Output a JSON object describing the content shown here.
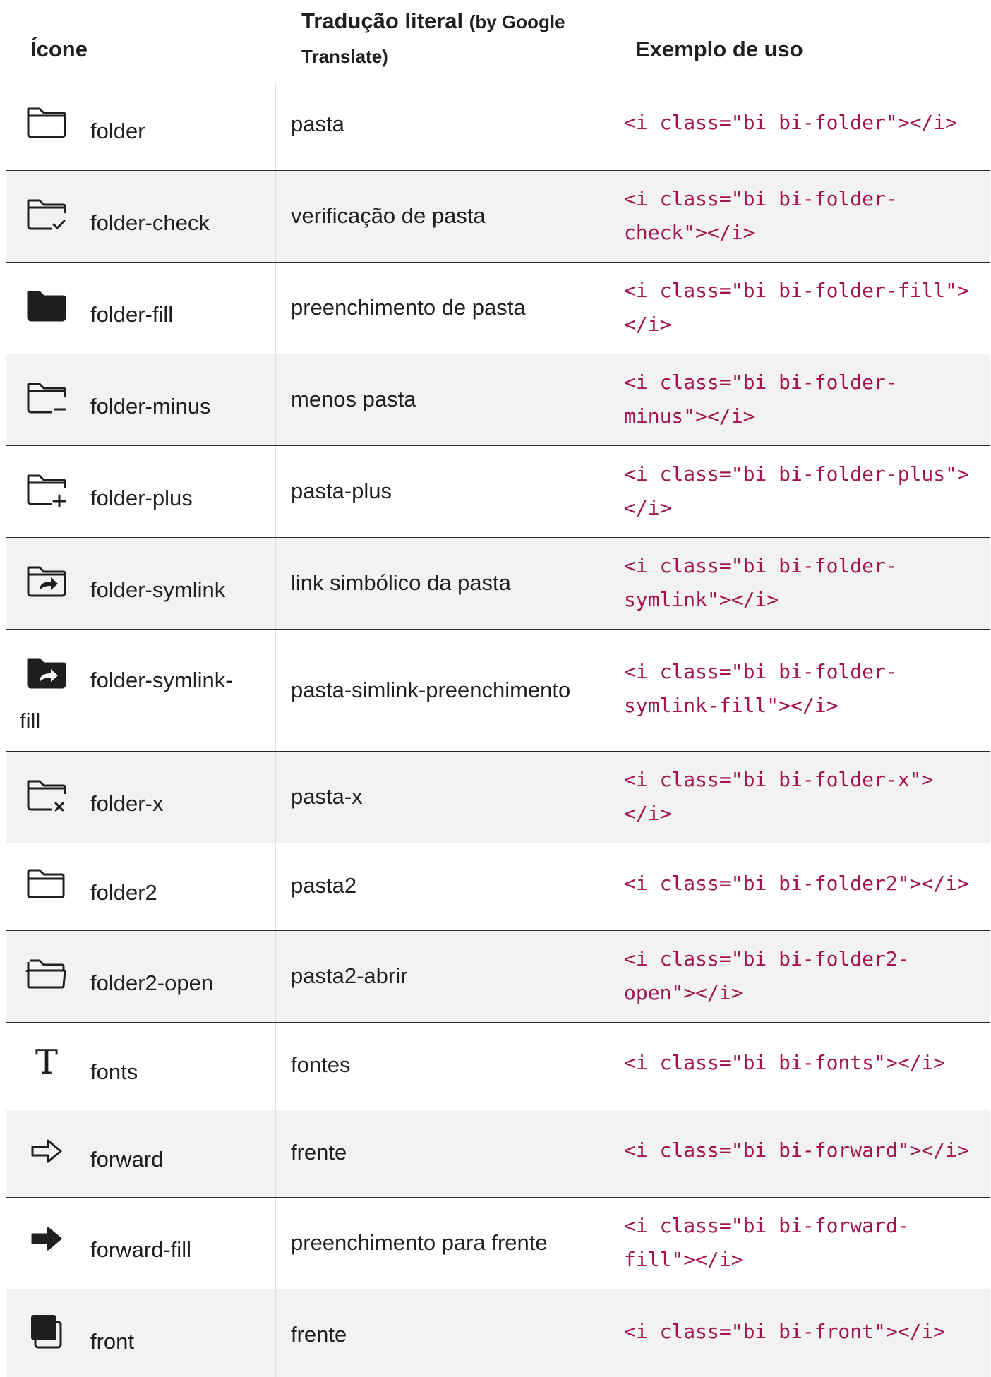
{
  "header": {
    "col_icon": "Ícone",
    "col_translation_main": "Tradução literal",
    "col_translation_note_1": "(by Google",
    "col_translation_note_2": "Translate)",
    "col_example": "Exemplo de uso"
  },
  "rows": [
    {
      "icon": "folder-icon",
      "name": "folder",
      "translation": "pasta",
      "code_1": "<i class=\"bi bi-folder\"></i>",
      "code_2": ""
    },
    {
      "icon": "folder-check-icon",
      "name": "folder-check",
      "translation": "verificação de pasta",
      "code_1": "<i class=\"bi bi-folder-",
      "code_2": "check\"></i>"
    },
    {
      "icon": "folder-fill-icon",
      "name": "folder-fill",
      "translation": "preenchimento de pasta",
      "code_1": "<i class=\"bi bi-folder-fill\">",
      "code_2": "</i>"
    },
    {
      "icon": "folder-minus-icon",
      "name": "folder-minus",
      "translation": "menos pasta",
      "code_1": "<i class=\"bi bi-folder-",
      "code_2": "minus\"></i>"
    },
    {
      "icon": "folder-plus-icon",
      "name": "folder-plus",
      "translation": "pasta-plus",
      "code_1": "<i class=\"bi bi-folder-plus\">",
      "code_2": "</i>"
    },
    {
      "icon": "folder-symlink-icon",
      "name": "folder-symlink",
      "translation": "link simbólico da pasta",
      "code_1": "<i class=\"bi bi-folder-",
      "code_2": "symlink\"></i>"
    },
    {
      "icon": "folder-symlink-fill-icon",
      "name": "folder-symlink-",
      "name_wrap": "fill",
      "translation": "pasta-simlink-preenchimento",
      "code_1": "<i class=\"bi bi-folder-",
      "code_2": "symlink-fill\"></i>"
    },
    {
      "icon": "folder-x-icon",
      "name": "folder-x",
      "translation": "pasta-x",
      "code_1": "<i class=\"bi bi-folder-x\">",
      "code_2": "</i>"
    },
    {
      "icon": "folder2-icon",
      "name": "folder2",
      "translation": "pasta2",
      "code_1": "<i class=\"bi bi-folder2\"></i>",
      "code_2": ""
    },
    {
      "icon": "folder2-open-icon",
      "name": "folder2-open",
      "translation": "pasta2-abrir",
      "code_1": "<i class=\"bi bi-folder2-",
      "code_2": "open\"></i>"
    },
    {
      "icon": "fonts-icon",
      "name": "fonts",
      "translation": "fontes",
      "code_1": "<i class=\"bi bi-fonts\"></i>",
      "code_2": ""
    },
    {
      "icon": "forward-icon",
      "name": "forward",
      "translation": "frente",
      "code_1": "<i class=\"bi bi-forward\"></i>",
      "code_2": ""
    },
    {
      "icon": "forward-fill-icon",
      "name": "forward-fill",
      "translation": "preenchimento para frente",
      "code_1": "<i class=\"bi bi-forward-",
      "code_2": "fill\"></i>"
    },
    {
      "icon": "front-icon",
      "name": "front",
      "translation": "frente",
      "code_1": "<i class=\"bi bi-front\"></i>",
      "code_2": ""
    }
  ],
  "colors": {
    "code": "#a3144f",
    "text": "#1f1f1f",
    "shaded_row": "#f2f2f2"
  }
}
